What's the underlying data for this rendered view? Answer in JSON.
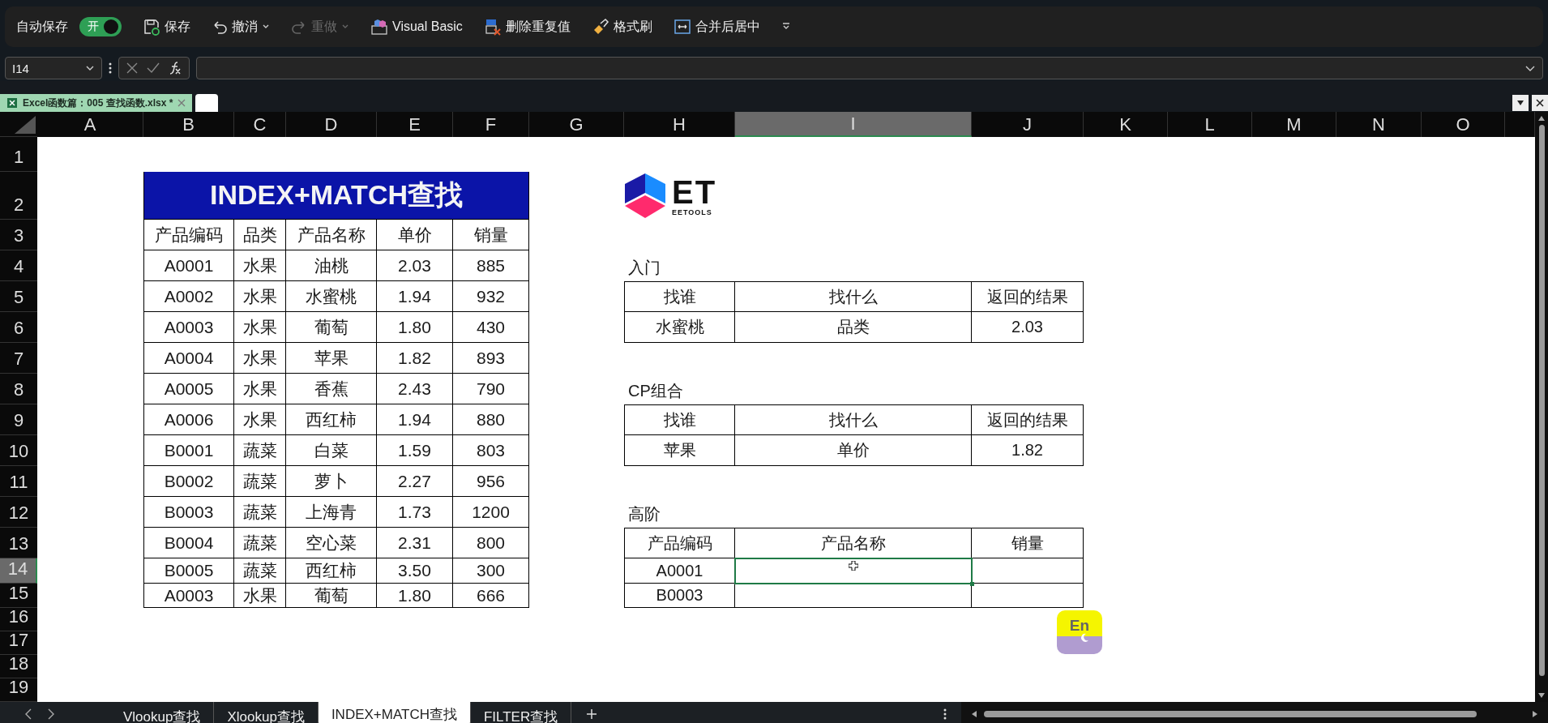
{
  "toolbar": {
    "autosave": {
      "label": "自动保存",
      "switch_label": "开",
      "on": true
    },
    "buttons": [
      {
        "kind": "save",
        "label": "保存",
        "disabled": false
      },
      {
        "kind": "undo",
        "label": "撤消",
        "disabled": false,
        "dropdown": true
      },
      {
        "kind": "redo",
        "label": "重做",
        "disabled": true,
        "dropdown": true
      },
      {
        "kind": "vba",
        "label": "Visual Basic",
        "disabled": false
      },
      {
        "kind": "dedupe",
        "label": "删除重复值",
        "disabled": false
      },
      {
        "kind": "painter",
        "label": "格式刷",
        "disabled": false
      },
      {
        "kind": "merge",
        "label": "合并后居中",
        "disabled": false
      }
    ]
  },
  "formula_bar": {
    "name_box": "I14"
  },
  "file_tab": {
    "title": "Excel函数篇：005 查找函数.xlsx *"
  },
  "columns": [
    {
      "letter": "A",
      "selected": false
    },
    {
      "letter": "B",
      "selected": false
    },
    {
      "letter": "C",
      "selected": false
    },
    {
      "letter": "D",
      "selected": false
    },
    {
      "letter": "E",
      "selected": false
    },
    {
      "letter": "F",
      "selected": false
    },
    {
      "letter": "G",
      "selected": false
    },
    {
      "letter": "H",
      "selected": false
    },
    {
      "letter": "I",
      "selected": true
    },
    {
      "letter": "J",
      "selected": false
    },
    {
      "letter": "K",
      "selected": false
    },
    {
      "letter": "L",
      "selected": false
    },
    {
      "letter": "M",
      "selected": false
    },
    {
      "letter": "N",
      "selected": false
    },
    {
      "letter": "O",
      "selected": false
    }
  ],
  "rows": [
    {
      "number": "1",
      "selected": false
    },
    {
      "number": "2",
      "selected": false
    },
    {
      "number": "3",
      "selected": false
    },
    {
      "number": "4",
      "selected": false
    },
    {
      "number": "5",
      "selected": false
    },
    {
      "number": "6",
      "selected": false
    },
    {
      "number": "7",
      "selected": false
    },
    {
      "number": "8",
      "selected": false
    },
    {
      "number": "9",
      "selected": false
    },
    {
      "number": "10",
      "selected": false
    },
    {
      "number": "11",
      "selected": false
    },
    {
      "number": "12",
      "selected": false
    },
    {
      "number": "13",
      "selected": false
    },
    {
      "number": "14",
      "selected": true
    },
    {
      "number": "15",
      "selected": false
    },
    {
      "number": "16",
      "selected": false
    },
    {
      "number": "17",
      "selected": false
    },
    {
      "number": "18",
      "selected": false
    },
    {
      "number": "19",
      "selected": false
    }
  ],
  "main_table": {
    "title": "INDEX+MATCH查找",
    "headers": [
      "产品编码",
      "品类",
      "产品名称",
      "单价",
      "销量"
    ],
    "rows": [
      [
        "A0001",
        "水果",
        "油桃",
        "2.03",
        "885"
      ],
      [
        "A0002",
        "水果",
        "水蜜桃",
        "1.94",
        "932"
      ],
      [
        "A0003",
        "水果",
        "葡萄",
        "1.80",
        "430"
      ],
      [
        "A0004",
        "水果",
        "苹果",
        "1.82",
        "893"
      ],
      [
        "A0005",
        "水果",
        "香蕉",
        "2.43",
        "790"
      ],
      [
        "A0006",
        "水果",
        "西红柿",
        "1.94",
        "880"
      ],
      [
        "B0001",
        "蔬菜",
        "白菜",
        "1.59",
        "803"
      ],
      [
        "B0002",
        "蔬菜",
        "萝卜",
        "2.27",
        "956"
      ],
      [
        "B0003",
        "蔬菜",
        "上海青",
        "1.73",
        "1200"
      ],
      [
        "B0004",
        "蔬菜",
        "空心菜",
        "2.31",
        "800"
      ],
      [
        "B0005",
        "蔬菜",
        "西红柿",
        "3.50",
        "300"
      ],
      [
        "A0003",
        "水果",
        "葡萄",
        "1.80",
        "666"
      ]
    ]
  },
  "logo": {
    "mark": "ET",
    "wordmark": "EETOOLS"
  },
  "lookup_sections": [
    {
      "label": "入门",
      "headers": [
        "找谁",
        "找什么",
        "返回的结果"
      ],
      "rows": [
        [
          "水蜜桃",
          "品类",
          "2.03"
        ]
      ]
    },
    {
      "label": "CP组合",
      "headers": [
        "找谁",
        "找什么",
        "返回的结果"
      ],
      "rows": [
        [
          "苹果",
          "单价",
          "1.82"
        ]
      ]
    },
    {
      "label": "高阶",
      "headers": [
        "产品编码",
        "产品名称",
        "销量"
      ],
      "rows": [
        [
          "A0001"
        ],
        [
          "B0003"
        ]
      ]
    }
  ],
  "ime_badge": {
    "label": "En"
  },
  "sheet_tabs": [
    {
      "label": "Vlookup查找",
      "selected": false
    },
    {
      "label": "Xlookup查找",
      "selected": false
    },
    {
      "label": "INDEX+MATCH查找",
      "selected": true
    },
    {
      "label": "FILTER查找",
      "selected": false
    }
  ]
}
